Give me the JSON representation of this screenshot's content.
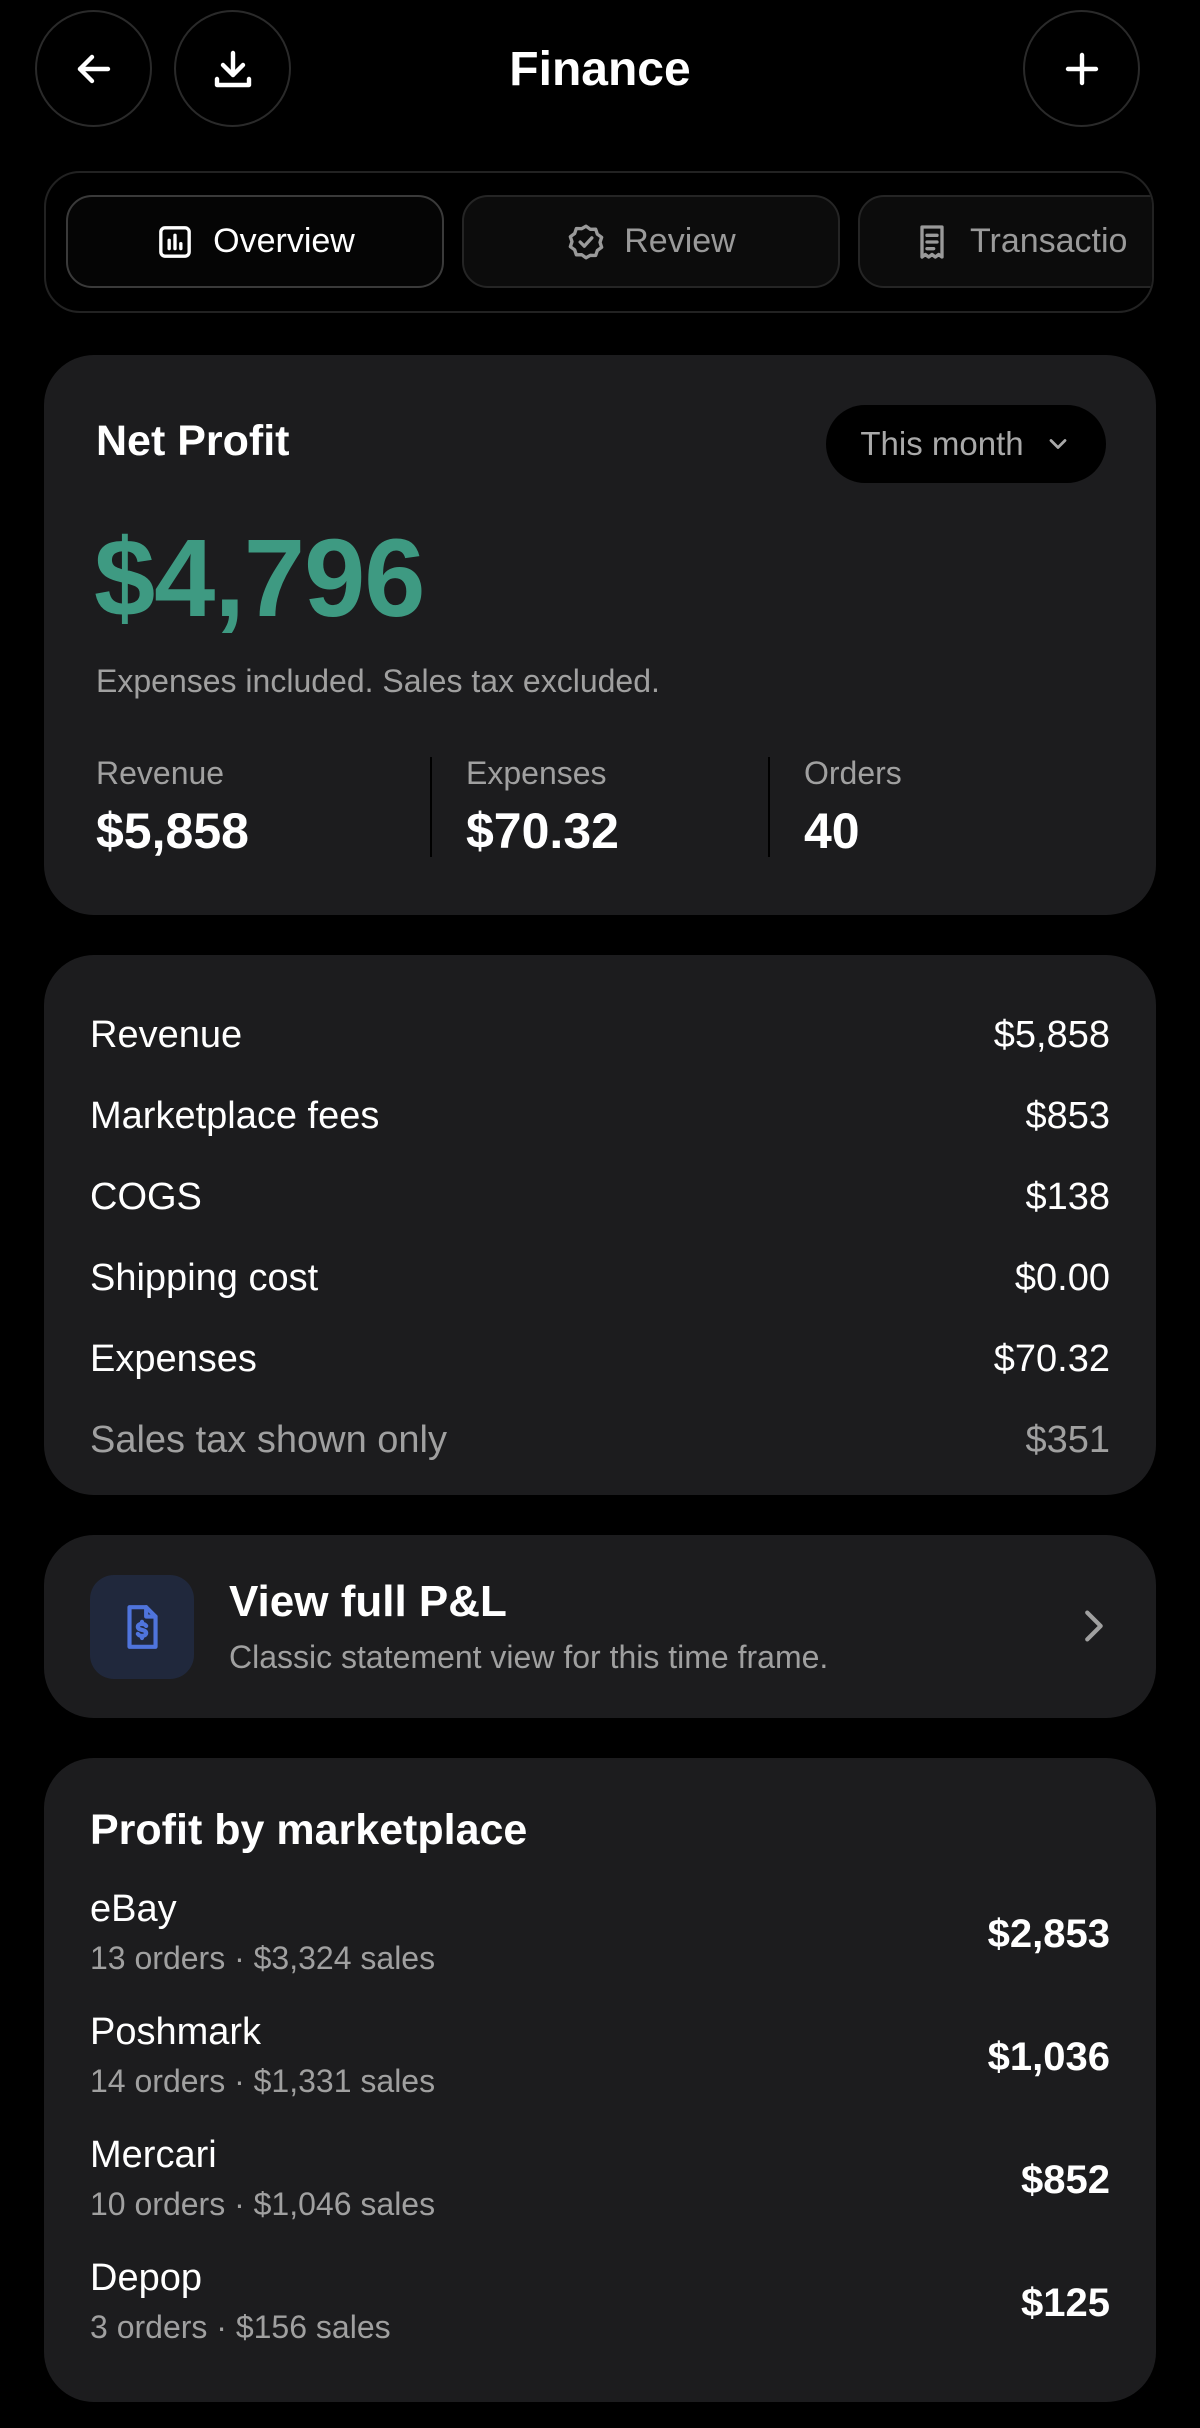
{
  "header": {
    "title": "Finance",
    "back_icon": "arrow-left-icon",
    "download_icon": "download-icon",
    "add_icon": "plus-icon"
  },
  "tabs": [
    {
      "label": "Overview",
      "icon": "bar-chart-icon",
      "active": true
    },
    {
      "label": "Review",
      "icon": "badge-check-icon",
      "active": false
    },
    {
      "label": "Transactio",
      "icon": "receipt-icon",
      "active": false
    }
  ],
  "net_profit": {
    "title": "Net Profit",
    "period": "This month",
    "value": "$4,796",
    "note": "Expenses included. Sales tax excluded.",
    "stats": [
      {
        "label": "Revenue",
        "value": "$5,858"
      },
      {
        "label": "Expenses",
        "value": "$70.32"
      },
      {
        "label": "Orders",
        "value": "40"
      }
    ]
  },
  "breakdown": [
    {
      "label": "Revenue",
      "value": "$5,858"
    },
    {
      "label": "Marketplace fees",
      "value": "$853"
    },
    {
      "label": "COGS",
      "value": "$138"
    },
    {
      "label": "Shipping cost",
      "value": "$0.00"
    },
    {
      "label": "Expenses",
      "value": "$70.32"
    },
    {
      "label": "Sales tax shown only",
      "value": "$351"
    }
  ],
  "pl": {
    "title": "View full P&L",
    "subtitle": "Classic statement view for this time frame."
  },
  "marketplace": {
    "title": "Profit by marketplace",
    "rows": [
      {
        "name": "eBay",
        "sub": "13 orders · $3,324 sales",
        "value": "$2,853"
      },
      {
        "name": "Poshmark",
        "sub": "14 orders · $1,331 sales",
        "value": "$1,036"
      },
      {
        "name": "Mercari",
        "sub": "10 orders · $1,046 sales",
        "value": "$852"
      },
      {
        "name": "Depop",
        "sub": "3 orders · $156 sales",
        "value": "$125"
      }
    ]
  },
  "colors": {
    "profit_green": "#3e9a82",
    "card_bg": "#1c1c1e",
    "icon_blue": "#4f74dc"
  }
}
